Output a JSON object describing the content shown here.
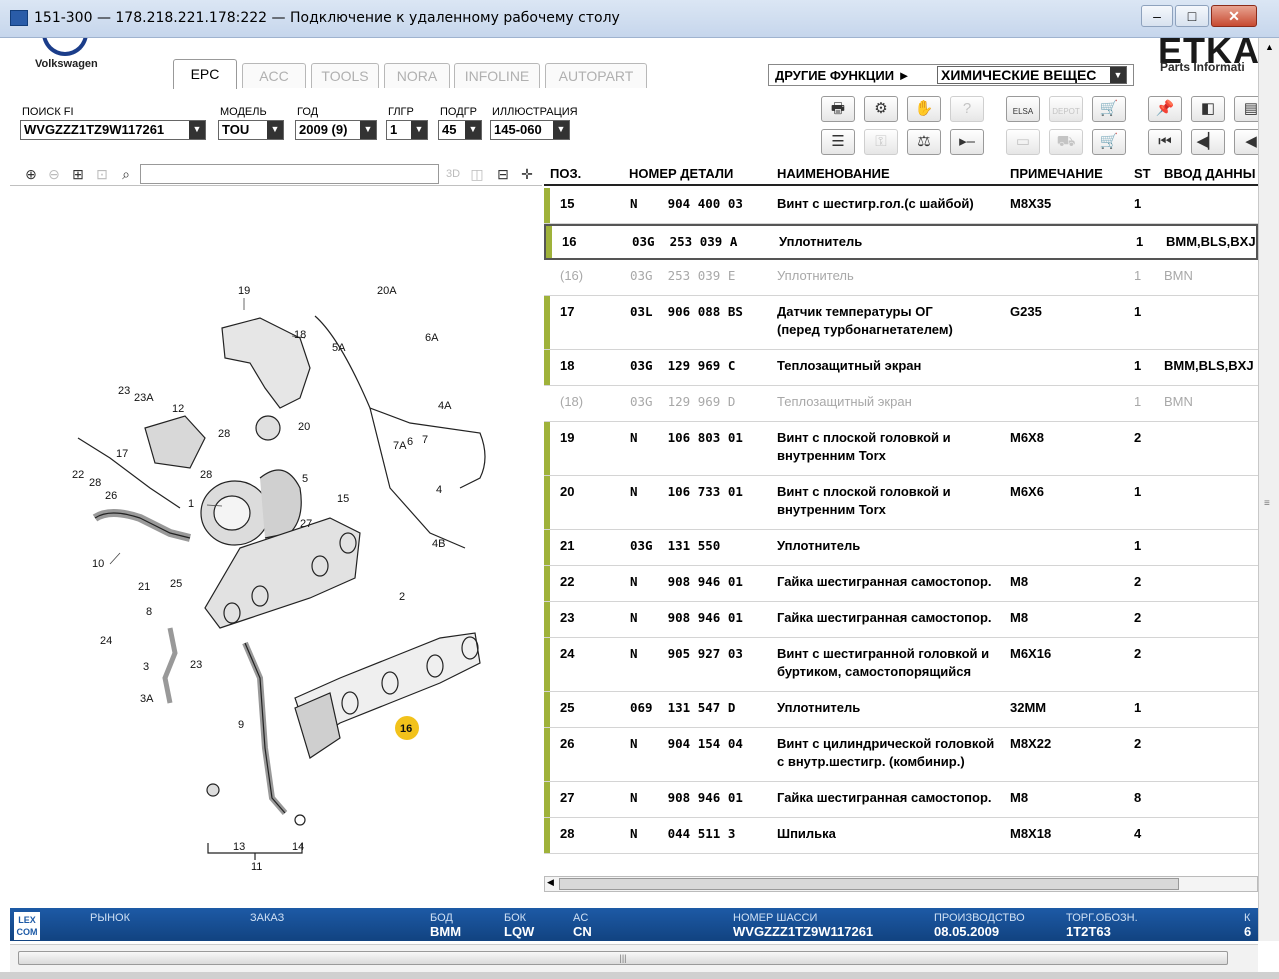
{
  "window": {
    "title": "151-300 — 178.218.221.178:222 — Подключение к удаленному рабочему столу"
  },
  "brand": {
    "vw": "Volkswagen",
    "etka": "ETKA",
    "etka_sub": "Parts Informati"
  },
  "tabs": [
    {
      "label": "EPC",
      "active": true
    },
    {
      "label": "ACC",
      "active": false
    },
    {
      "label": "TOOLS",
      "active": false
    },
    {
      "label": "NORA",
      "active": false
    },
    {
      "label": "INFOLINE",
      "active": false
    },
    {
      "label": "AUTOPART",
      "active": false
    }
  ],
  "other_functions": {
    "label": "ДРУГИЕ ФУНКЦИИ ►",
    "value": "ХИМИЧЕСКИЕ ВЕЩЕС"
  },
  "filters": {
    "search_fi": {
      "label": "ПОИСК FI",
      "value": "WVGZZZ1TZ9W117261"
    },
    "model": {
      "label": "МОДЕЛЬ",
      "value": "TOU"
    },
    "year": {
      "label": "ГОД",
      "value": "2009 (9)"
    },
    "glgr": {
      "label": "ГЛГР",
      "value": "1"
    },
    "podgr": {
      "label": "ПОДГР",
      "value": "45"
    },
    "illustration": {
      "label": "ИЛЛЮСТРАЦИЯ",
      "value": "145-060"
    }
  },
  "toolbar": {
    "elsa": "ELSA",
    "depot": "DEPOT"
  },
  "table": {
    "headers": {
      "pos": "ПОЗ.",
      "part": "НОМЕР ДЕТАЛИ",
      "name": "НАИМЕНОВАНИЕ",
      "note": "ПРИМЕЧАНИЕ",
      "st": "ST",
      "input": "ВВОД ДАННЫ"
    },
    "rows": [
      {
        "pos": "15",
        "part": "N    904 400 03",
        "name": "Винт с шестигр.гол.(с шайбой)",
        "name2": "",
        "note": "M8X35",
        "st": "1",
        "input": ""
      },
      {
        "pos": "16",
        "part": "03G  253 039 A",
        "name": "Уплотнитель",
        "name2": "",
        "note": "",
        "st": "1",
        "input": "BMM,BLS,BXJ"
      },
      {
        "pos": "(16)",
        "part": "03G  253 039 E",
        "name": "Уплотнитель",
        "name2": "",
        "note": "",
        "st": "1",
        "input": "BMN"
      },
      {
        "pos": "17",
        "part": "03L  906 088 BS",
        "name": "Датчик температуры ОГ",
        "name2": "(перед турбонагнетателем)",
        "note": "G235",
        "st": "1",
        "input": ""
      },
      {
        "pos": "18",
        "part": "03G  129 969 C",
        "name": "Теплозащитный экран",
        "name2": "",
        "note": "",
        "st": "1",
        "input": "BMM,BLS,BXJ"
      },
      {
        "pos": "(18)",
        "part": "03G  129 969 D",
        "name": "Теплозащитный экран",
        "name2": "",
        "note": "",
        "st": "1",
        "input": "BMN"
      },
      {
        "pos": "19",
        "part": "N    106 803 01",
        "name": "Винт с плоской головкой и",
        "name2": "внутренним Torx",
        "note": "M6X8",
        "st": "2",
        "input": ""
      },
      {
        "pos": "20",
        "part": "N    106 733 01",
        "name": "Винт с плоской головкой и",
        "name2": "внутренним Torx",
        "note": "M6X6",
        "st": "1",
        "input": ""
      },
      {
        "pos": "21",
        "part": "03G  131 550",
        "name": "Уплотнитель",
        "name2": "",
        "note": "",
        "st": "1",
        "input": ""
      },
      {
        "pos": "22",
        "part": "N    908 946 01",
        "name": "Гайка шестигранная самостопор.",
        "name2": "",
        "note": "M8",
        "st": "2",
        "input": ""
      },
      {
        "pos": "23",
        "part": "N    908 946 01",
        "name": "Гайка шестигранная самостопор.",
        "name2": "",
        "note": "M8",
        "st": "2",
        "input": ""
      },
      {
        "pos": "24",
        "part": "N    905 927 03",
        "name": "Винт с шестигранной головкой и",
        "name2": "буртиком, самостопорящийся",
        "note": "M6X16",
        "st": "2",
        "input": ""
      },
      {
        "pos": "25",
        "part": "069  131 547 D",
        "name": "Уплотнитель",
        "name2": "",
        "note": "32MM",
        "st": "1",
        "input": ""
      },
      {
        "pos": "26",
        "part": "N    904 154 04",
        "name": "Винт с цилиндрической головкой",
        "name2": "с внутр.шестигр. (комбинир.)",
        "note": "M8X22",
        "st": "2",
        "input": ""
      },
      {
        "pos": "27",
        "part": "N    908 946 01",
        "name": "Гайка шестигранная самостопор.",
        "name2": "",
        "note": "M8",
        "st": "8",
        "input": ""
      },
      {
        "pos": "28",
        "part": "N    044 511 3",
        "name": "Шпилька",
        "name2": "",
        "note": "M8X18",
        "st": "4",
        "input": ""
      }
    ]
  },
  "diagram": {
    "callouts": [
      "19",
      "18",
      "20A",
      "6A",
      "5A",
      "23",
      "23A",
      "12",
      "28",
      "20",
      "4A",
      "7A",
      "6",
      "7",
      "17",
      "22",
      "28",
      "26",
      "5",
      "15",
      "1",
      "4",
      "27",
      "4B",
      "10",
      "21",
      "25",
      "8",
      "2",
      "24",
      "3",
      "23",
      "3A",
      "16",
      "9",
      "13",
      "14",
      "11"
    ]
  },
  "status": {
    "lexcom": "LEX COM",
    "market": {
      "label": "РЫНОК",
      "value": ""
    },
    "order": {
      "label": "ЗАКАЗ",
      "value": ""
    },
    "bod": {
      "label": "БОД",
      "value": "BMM"
    },
    "bok": {
      "label": "БОК",
      "value": "LQW"
    },
    "ac": {
      "label": "AC",
      "value": "CN"
    },
    "chassis": {
      "label": "НОМЕР ШАССИ",
      "value": "WVGZZZ1TZ9W117261"
    },
    "production": {
      "label": "ПРОИЗВОДСТВО",
      "value": "08.05.2009"
    },
    "trade": {
      "label": "ТОРГ.ОБОЗН.",
      "value": "1T2T63"
    },
    "extra": {
      "label": "К",
      "value": "6"
    }
  }
}
